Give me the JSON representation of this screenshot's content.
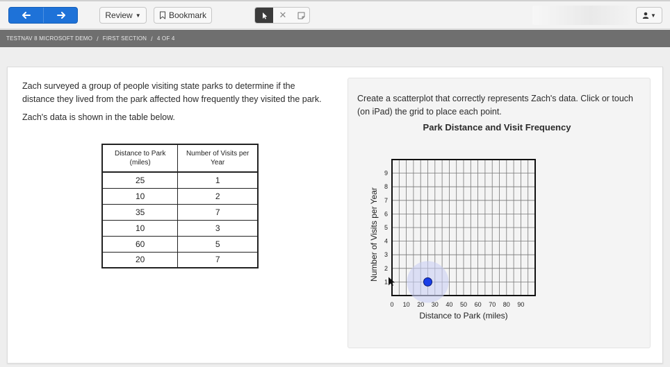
{
  "toolbar": {
    "review_label": "Review",
    "bookmark_label": "Bookmark"
  },
  "breadcrumb": {
    "test_name": "TESTNAV 8 MICROSOFT DEMO",
    "section": "FIRST SECTION",
    "position": "4 OF 4",
    "separator": "/"
  },
  "question": {
    "intro": "Zach surveyed a group of people visiting state parks to determine if the distance they lived from the park affected how frequently they visited the park.",
    "table_intro": "Zach's data is shown in the table below.",
    "table": {
      "headers": [
        "Distance to Park (miles)",
        "Number of Visits per Year"
      ],
      "rows": [
        [
          "25",
          "1"
        ],
        [
          "10",
          "2"
        ],
        [
          "35",
          "7"
        ],
        [
          "10",
          "3"
        ],
        [
          "60",
          "5"
        ],
        [
          "20",
          "7"
        ]
      ]
    }
  },
  "answer_panel": {
    "prompt": "Create a scatterplot that correctly represents Zach's data. Click or touch (on iPad) the grid to place each point."
  },
  "colors": {
    "accent": "#1e72d8",
    "point": "#1a3ee8",
    "point_halo": "#c9cff4"
  },
  "chart_data": {
    "type": "scatter",
    "title": "Park Distance and Visit Frequency",
    "xlabel": "Distance to Park (miles)",
    "ylabel": "Number of Visits per Year",
    "xlim": [
      0,
      100
    ],
    "ylim": [
      0,
      10
    ],
    "x_ticks": [
      0,
      10,
      20,
      30,
      40,
      50,
      60,
      70,
      80,
      90
    ],
    "y_ticks": [
      1,
      2,
      3,
      4,
      5,
      6,
      7,
      8,
      9
    ],
    "grid": true,
    "points": [
      {
        "x": 25,
        "y": 1
      }
    ]
  }
}
